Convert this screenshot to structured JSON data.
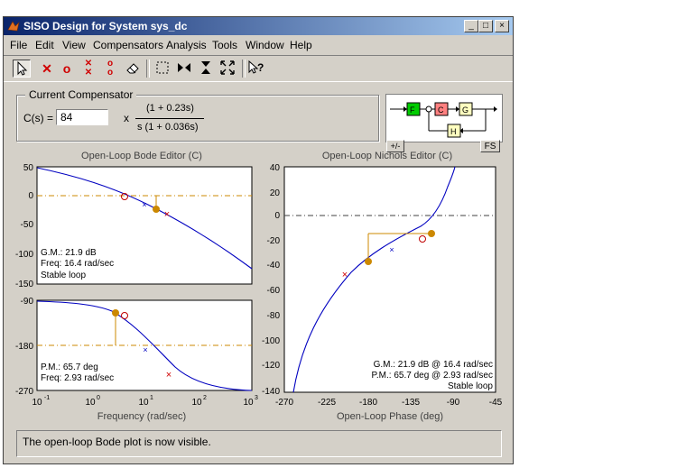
{
  "window": {
    "title": "SISO Design for System sys_dc",
    "controls": [
      "_",
      "□",
      "×"
    ]
  },
  "menu": [
    "File",
    "Edit",
    "View",
    "Compensators",
    "Analysis",
    "Tools",
    "Window",
    "Help"
  ],
  "compensator": {
    "legend": "Current Compensator",
    "label": "C(s) =",
    "gain": "84",
    "times": "x",
    "numerator": "(1 + 0.23s)",
    "denominator": "s (1 + 0.036s)"
  },
  "blocks": {
    "F": "F",
    "C": "C",
    "G": "G",
    "H": "H",
    "sign_btn": "+/-",
    "fs_btn": "FS"
  },
  "bode_mag": {
    "title": "Open-Loop Bode Editor (C)",
    "yticks": [
      "50",
      "0",
      "-50",
      "-100",
      "-150"
    ],
    "info": [
      "G.M.: 21.9 dB",
      "Freq: 16.4 rad/sec",
      "Stable loop"
    ]
  },
  "bode_phase": {
    "yticks": [
      "-90",
      "-180",
      "-270"
    ],
    "xticks": [
      [
        "10",
        "-1"
      ],
      [
        "10",
        "0"
      ],
      [
        "10",
        "1"
      ],
      [
        "10",
        "2"
      ],
      [
        "10",
        "3"
      ]
    ],
    "xlabel": "Frequency  (rad/sec)",
    "info": [
      "P.M.: 65.7 deg",
      "Freq: 2.93 rad/sec"
    ]
  },
  "nichols": {
    "title": "Open-Loop Nichols Editor (C)",
    "yticks": [
      "40",
      "20",
      "0",
      "-20",
      "-40",
      "-60",
      "-80",
      "-100",
      "-120",
      "-140"
    ],
    "xticks": [
      "-270",
      "-225",
      "-180",
      "-135",
      "-90",
      "-45"
    ],
    "xlabel": "Open-Loop Phase (deg)",
    "info": [
      "G.M.: 21.9 dB @ 16.4 rad/sec",
      "P.M.: 65.7 deg @ 2.93 rad/sec",
      "Stable loop"
    ]
  },
  "status": "The open-loop Bode plot is now visible.",
  "colors": {
    "curve": "#0000c0",
    "margin": "#cc8800",
    "pole": "#d00000",
    "zero": "#c00000",
    "titlebar": "#0a246a"
  }
}
